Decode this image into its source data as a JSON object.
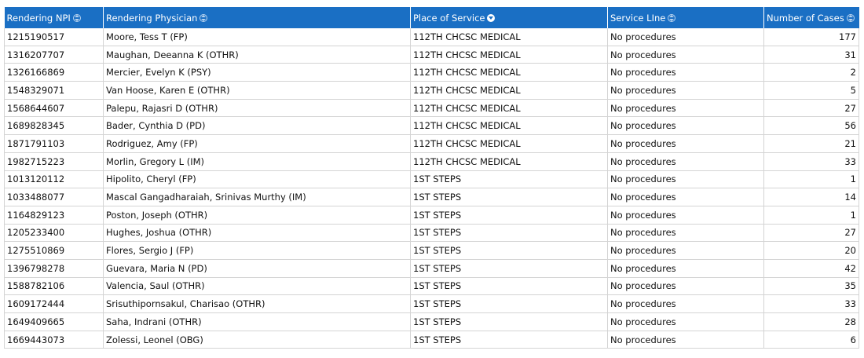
{
  "table": {
    "columns": [
      {
        "label": "Rendering NPI"
      },
      {
        "label": "Rendering Physician"
      },
      {
        "label": "Place of Service"
      },
      {
        "label": "Service LIne"
      },
      {
        "label": "Number of Cases"
      }
    ],
    "sort": {
      "column": "Place of Service",
      "direction": "ascending"
    },
    "icons": {
      "sortable": "sort-both-icon",
      "sorted": "sort-descending-icon"
    },
    "colors": {
      "header_bg": "#1a6fc4",
      "header_text": "#ffffff",
      "grid_line": "#d4d4d4"
    },
    "rows": [
      {
        "npi": "1215190517",
        "physician": "Moore, Tess T (FP)",
        "place": "112TH CHCSC MEDICAL",
        "service": "No procedures",
        "cases": "177"
      },
      {
        "npi": "1316207707",
        "physician": "Maughan, Deeanna K (OTHR)",
        "place": "112TH CHCSC MEDICAL",
        "service": "No procedures",
        "cases": "31"
      },
      {
        "npi": "1326166869",
        "physician": "Mercier, Evelyn K (PSY)",
        "place": "112TH CHCSC MEDICAL",
        "service": "No procedures",
        "cases": "2"
      },
      {
        "npi": "1548329071",
        "physician": "Van Hoose, Karen E (OTHR)",
        "place": "112TH CHCSC MEDICAL",
        "service": "No procedures",
        "cases": "5"
      },
      {
        "npi": "1568644607",
        "physician": "Palepu, Rajasri D (OTHR)",
        "place": "112TH CHCSC MEDICAL",
        "service": "No procedures",
        "cases": "27"
      },
      {
        "npi": "1689828345",
        "physician": "Bader, Cynthia D (PD)",
        "place": "112TH CHCSC MEDICAL",
        "service": "No procedures",
        "cases": "56"
      },
      {
        "npi": "1871791103",
        "physician": "Rodriguez, Amy (FP)",
        "place": "112TH CHCSC MEDICAL",
        "service": "No procedures",
        "cases": "21"
      },
      {
        "npi": "1982715223",
        "physician": "Morlin, Gregory L (IM)",
        "place": "112TH CHCSC MEDICAL",
        "service": "No procedures",
        "cases": "33"
      },
      {
        "npi": "1013120112",
        "physician": "Hipolito, Cheryl (FP)",
        "place": "1ST STEPS",
        "service": "No procedures",
        "cases": "1"
      },
      {
        "npi": "1033488077",
        "physician": "Mascal Gangadharaiah, Srinivas Murthy  (IM)",
        "place": "1ST STEPS",
        "service": "No procedures",
        "cases": "14"
      },
      {
        "npi": "1164829123",
        "physician": "Poston, Joseph  (OTHR)",
        "place": "1ST STEPS",
        "service": "No procedures",
        "cases": "1"
      },
      {
        "npi": "1205233400",
        "physician": "Hughes, Joshua  (OTHR)",
        "place": "1ST STEPS",
        "service": "No procedures",
        "cases": "27"
      },
      {
        "npi": "1275510869",
        "physician": "Flores, Sergio J (FP)",
        "place": "1ST STEPS",
        "service": "No procedures",
        "cases": "20"
      },
      {
        "npi": "1396798278",
        "physician": "Guevara, Maria N (PD)",
        "place": "1ST STEPS",
        "service": "No procedures",
        "cases": "42"
      },
      {
        "npi": "1588782106",
        "physician": "Valencia, Saul (OTHR)",
        "place": "1ST STEPS",
        "service": "No procedures",
        "cases": "35"
      },
      {
        "npi": "1609172444",
        "physician": "Srisuthipornsakul, Charisao  (OTHR)",
        "place": "1ST STEPS",
        "service": "No procedures",
        "cases": "33"
      },
      {
        "npi": "1649409665",
        "physician": "Saha, Indrani (OTHR)",
        "place": "1ST STEPS",
        "service": "No procedures",
        "cases": "28"
      },
      {
        "npi": "1669443073",
        "physician": "Zolessi, Leonel (OBG)",
        "place": "1ST STEPS",
        "service": "No procedures",
        "cases": "6"
      }
    ]
  }
}
